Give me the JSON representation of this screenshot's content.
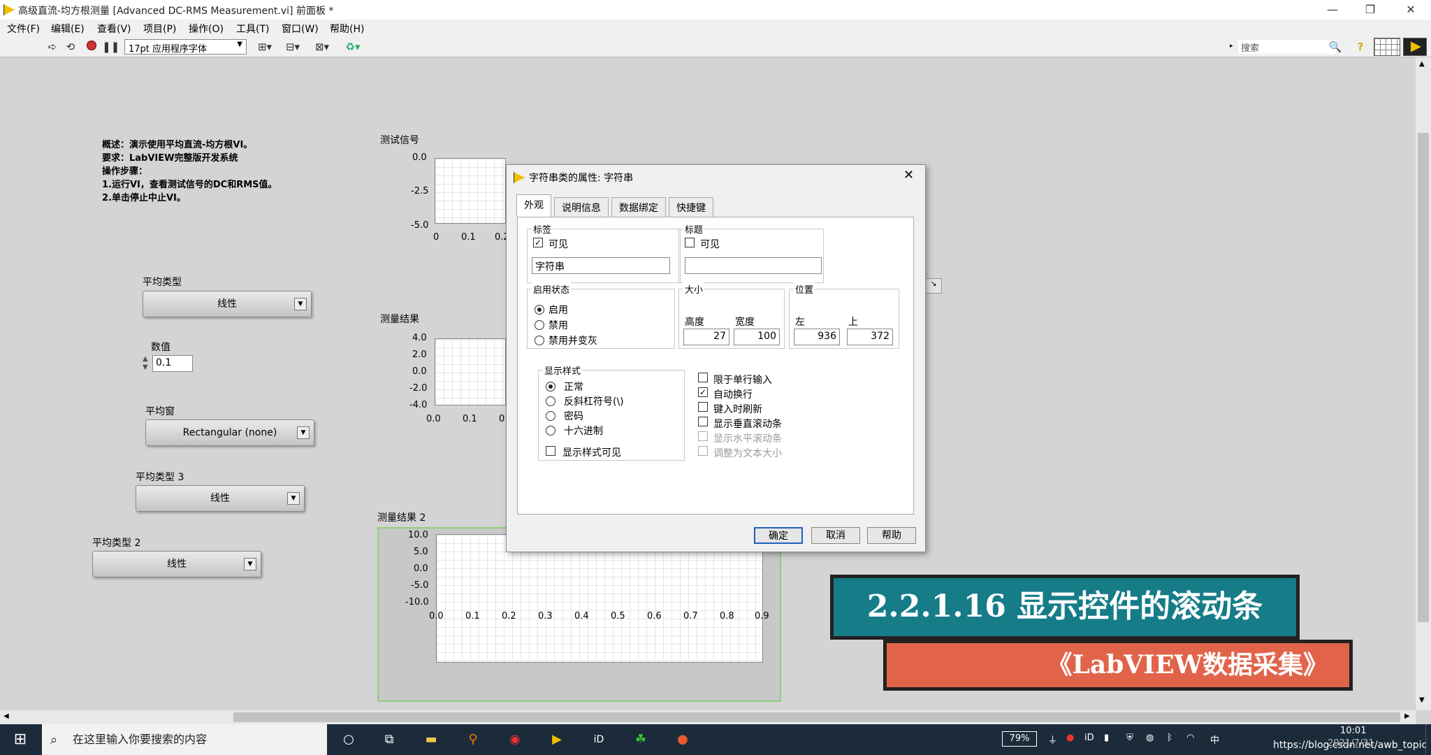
{
  "window": {
    "title": "高级直流-均方根测量 [Advanced DC-RMS Measurement.vi] 前面板 *",
    "min": "—",
    "max": "❐",
    "close": "✕"
  },
  "menu": [
    "文件(F)",
    "编辑(E)",
    "查看(V)",
    "项目(P)",
    "操作(O)",
    "工具(T)",
    "窗口(W)",
    "帮助(H)"
  ],
  "toolbar": {
    "font": "17pt 应用程序字体",
    "search_placeholder": "搜索"
  },
  "panel": {
    "description": [
      "概述：演示使用平均直流-均方根VI。",
      "要求：LabVIEW完整版开发系统",
      "操作步骤：",
      "1.运行VI，查看测试信号的DC和RMS值。",
      "2.单击停止中止VI。"
    ],
    "avg_type": {
      "label": "平均类型",
      "value": "线性"
    },
    "numeric": {
      "label": "数值",
      "value": "0.1"
    },
    "window": {
      "label": "平均窗",
      "value": "Rectangular (none)"
    },
    "avg_type3": {
      "label": "平均类型 3",
      "value": "线性"
    },
    "avg_type2": {
      "label": "平均类型 2",
      "value": "线性"
    }
  },
  "charts": {
    "test_signal": {
      "label": "测试信号",
      "yticks": [
        "0.0",
        "-2.5",
        "-5.0"
      ],
      "xticks": [
        "0",
        "0.1",
        "0.2"
      ]
    },
    "result": {
      "label": "测量结果",
      "yticks": [
        "4.0",
        "2.0",
        "0.0",
        "-2.0",
        "-4.0"
      ],
      "xticks": [
        "0.0",
        "0.1",
        "0"
      ]
    },
    "result2": {
      "label": "测量结果 2",
      "yticks": [
        "10.0",
        "5.0",
        "0.0",
        "-5.0",
        "-10.0"
      ],
      "xticks": [
        "0.0",
        "0.1",
        "0.2",
        "0.3",
        "0.4",
        "0.5",
        "0.6",
        "0.7",
        "0.8",
        "0.9"
      ]
    }
  },
  "dialog": {
    "title": "字符串类的属性: 字符串",
    "tabs": [
      "外观",
      "说明信息",
      "数据绑定",
      "快捷键"
    ],
    "label_group": {
      "title": "标签",
      "visible": "可见",
      "text": "字符串"
    },
    "caption_group": {
      "title": "标题",
      "visible": "可见",
      "text": ""
    },
    "enable_group": {
      "title": "启用状态",
      "options": [
        "启用",
        "禁用",
        "禁用并变灰"
      ]
    },
    "size_group": {
      "title": "大小",
      "height_label": "高度",
      "width_label": "宽度",
      "height": "27",
      "width": "100"
    },
    "pos_group": {
      "title": "位置",
      "left_label": "左",
      "top_label": "上",
      "left": "936",
      "top": "372"
    },
    "display_group": {
      "title": "显示样式",
      "options": [
        "正常",
        "反斜杠符号(\\)",
        "密码",
        "十六进制"
      ],
      "style_visible": "显示样式可见"
    },
    "checks": [
      "限于单行输入",
      "自动换行",
      "键入时刷新",
      "显示垂直滚动条",
      "显示水平滚动条",
      "调整为文本大小"
    ],
    "buttons": {
      "ok": "确定",
      "cancel": "取消",
      "help": "帮助"
    }
  },
  "banner": {
    "title": "2.2.1.16 显示控件的滚动条",
    "subtitle": "《LabVIEW数据采集》"
  },
  "taskbar": {
    "search": "在这里输入你要搜索的内容",
    "battery": "79%",
    "time": "10:01",
    "date": "2021/7/31",
    "watermark": "https://blog.csdn.net/awb_topic",
    "lang": "中"
  }
}
